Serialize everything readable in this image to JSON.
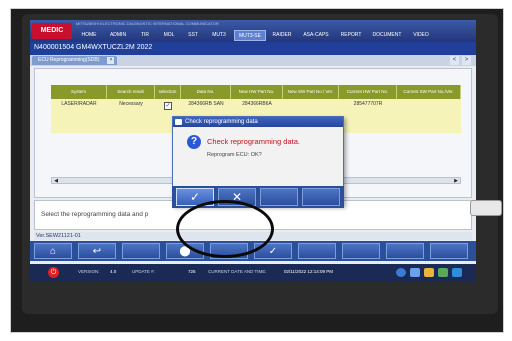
{
  "app": {
    "logo": "MEDIC",
    "title": "MITSUBISHI ELECTRONIC DIAGNOSTIC INTERNATIONAL COMMUNICATOR",
    "menu": [
      {
        "label": "HOME",
        "active": false
      },
      {
        "label": "ADMIN",
        "active": false
      },
      {
        "label": "TIR",
        "active": false
      },
      {
        "label": "MOL",
        "active": false
      },
      {
        "label": "SST",
        "active": false
      },
      {
        "label": "MUT3",
        "active": false
      },
      {
        "label": "MUT3-SE",
        "active": true
      },
      {
        "label": "RAIDER",
        "active": false
      },
      {
        "label": "ASA-CAPS",
        "active": false
      },
      {
        "label": "REPORT",
        "active": false
      },
      {
        "label": "DOCUMENT",
        "active": false
      },
      {
        "label": "VIDEO",
        "active": false
      }
    ],
    "vehicle_id": "N400001504  GM4WXTUCZL2M 2022"
  },
  "tab": {
    "label": "ECU Reprogramming(SDB)",
    "close": "×",
    "prev": "<",
    "next": ">"
  },
  "table": {
    "headers": [
      "System",
      "Search result",
      "selection",
      "Data No.",
      "New HW Part No.",
      "New SW Part No / Ver.",
      "Current HW Part No.",
      "Current SW Part No./Ver."
    ],
    "rows": [
      {
        "system": "LASER/RADAR",
        "search_result": "Necessary",
        "selection": "✓",
        "data_no": "284366RB SAN",
        "new_hw": "284366RB6A",
        "new_sw": "",
        "current_hw": "285477707R",
        "current_sw": ""
      }
    ]
  },
  "scrollbar": {
    "left": "◀",
    "right": "▶"
  },
  "message": "Select the reprogramming data and p",
  "version": "Ver.SEW21121-01",
  "bottom_toolbar": [
    "⌂",
    "↩",
    "",
    "⬤",
    "",
    "✓",
    "",
    "",
    "",
    ""
  ],
  "status": {
    "power": "⏻",
    "version_label": "VERSION:",
    "version_value": "4.0",
    "update_label": "UPDATE #:",
    "update_value": "726",
    "datetime_label": "CURRENT DATE AND TIME:",
    "datetime_value": "02/11/2022 12:14:09 PM"
  },
  "dialog": {
    "title": "Check reprogramming data",
    "heading": "Check reprogramming data.",
    "subtext": "Reprogram ECU: OK?",
    "ok": "✓",
    "cancel": "✕"
  },
  "colors": {
    "accent": "#2c4f9a",
    "dialog_heading": "#c8101c",
    "table_header": "#8a9a2a",
    "row_highlight": "#f6f3b8"
  }
}
